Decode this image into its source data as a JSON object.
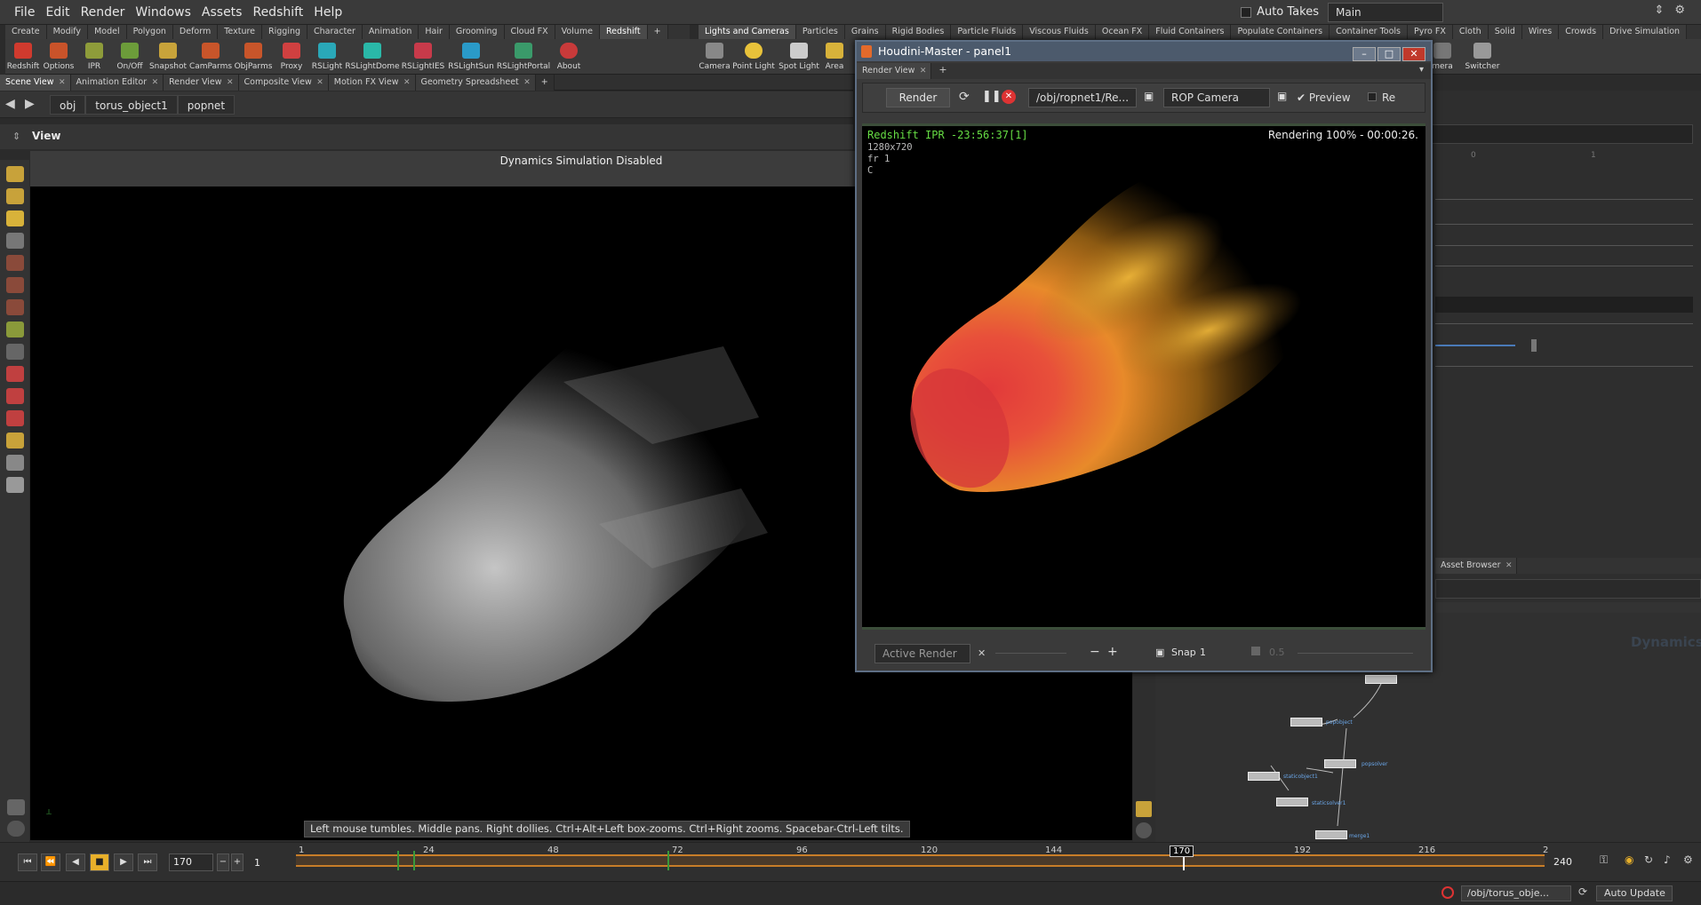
{
  "menu": {
    "items": [
      "File",
      "Edit",
      "Render",
      "Windows",
      "Assets",
      "Redshift",
      "Help"
    ],
    "auto_takes": "Auto Takes",
    "take": "Main"
  },
  "shelf_tabs_left": [
    "Create",
    "Modify",
    "Model",
    "Polygon",
    "Deform",
    "Texture",
    "Rigging",
    "Character",
    "Animation",
    "Hair",
    "Grooming",
    "Cloud FX",
    "Volume",
    "Redshift",
    "+"
  ],
  "shelf_tools_left": [
    "Redshift",
    "Options",
    "IPR",
    "On/Off",
    "Snapshot",
    "CamParms",
    "ObjParms",
    "Proxy",
    "RSLight",
    "RSLightDome",
    "RSLightIES",
    "RSLightSun",
    "RSLightPortal",
    "About"
  ],
  "shelf_tabs_right": [
    "Lights and Cameras",
    "Particles",
    "Grains",
    "Rigid Bodies",
    "Particle Fluids",
    "Viscous Fluids",
    "Ocean FX",
    "Fluid Containers",
    "Populate Containers",
    "Container Tools",
    "Pyro FX",
    "Cloth",
    "Solid",
    "Wires",
    "Crowds",
    "Drive Simulation",
    "+"
  ],
  "shelf_tools_right": [
    "Camera",
    "Point Light",
    "Spot Light",
    "Area",
    "mera",
    "Switcher"
  ],
  "pane_tabs": [
    "Scene View",
    "Animation Editor",
    "Render View",
    "Composite View",
    "Motion FX View",
    "Geometry Spreadsheet",
    "+"
  ],
  "path": {
    "root": "obj",
    "object": "torus_object1",
    "node": "popnet"
  },
  "view_title": "View",
  "dyn_banner": "Dynamics Simulation Disabled",
  "hint": "Left mouse tumbles. Middle pans. Right dollies. Ctrl+Alt+Left box-zooms. Ctrl+Right zooms. Spacebar-Ctrl-Left tilts.",
  "float_window": {
    "title": "Houdini-Master - panel1",
    "tab": "Render View",
    "render_btn": "Render",
    "rop_path": "/obj/ropnet1/Re...",
    "camera": "ROP Camera",
    "preview": "Preview",
    "re": "Re",
    "ipr_status": "Redshift IPR -23:56:37[1]",
    "ipr_res": "1280x720",
    "ipr_frame": "fr 1",
    "ipr_c": "C",
    "progress": "Rendering 100% - 00:00:26.",
    "active_render": "Active Render",
    "snap": "Snap",
    "snap_val": "1",
    "zoom_val": "0.5"
  },
  "right_panel": {
    "ruler_0": "0",
    "ruler_1": "1",
    "asset_tab": "Asset Browser",
    "dyn_watermark": "Dynamics"
  },
  "network_nodes": [
    {
      "label": "popobject"
    },
    {
      "label": "popsolver"
    },
    {
      "label": "staticobject1"
    },
    {
      "label": "staticsolver1"
    },
    {
      "label": "merge1"
    }
  ],
  "timeline": {
    "frame": "170",
    "start": "1",
    "end": "240",
    "ticks": [
      "1",
      "24",
      "48",
      "72",
      "96",
      "120",
      "144",
      "170",
      "192",
      "216",
      "2"
    ],
    "current_tick": "170",
    "progress_fraction": 0.71
  },
  "status": {
    "path": "/obj/torus_obje...",
    "update": "Auto Update"
  }
}
